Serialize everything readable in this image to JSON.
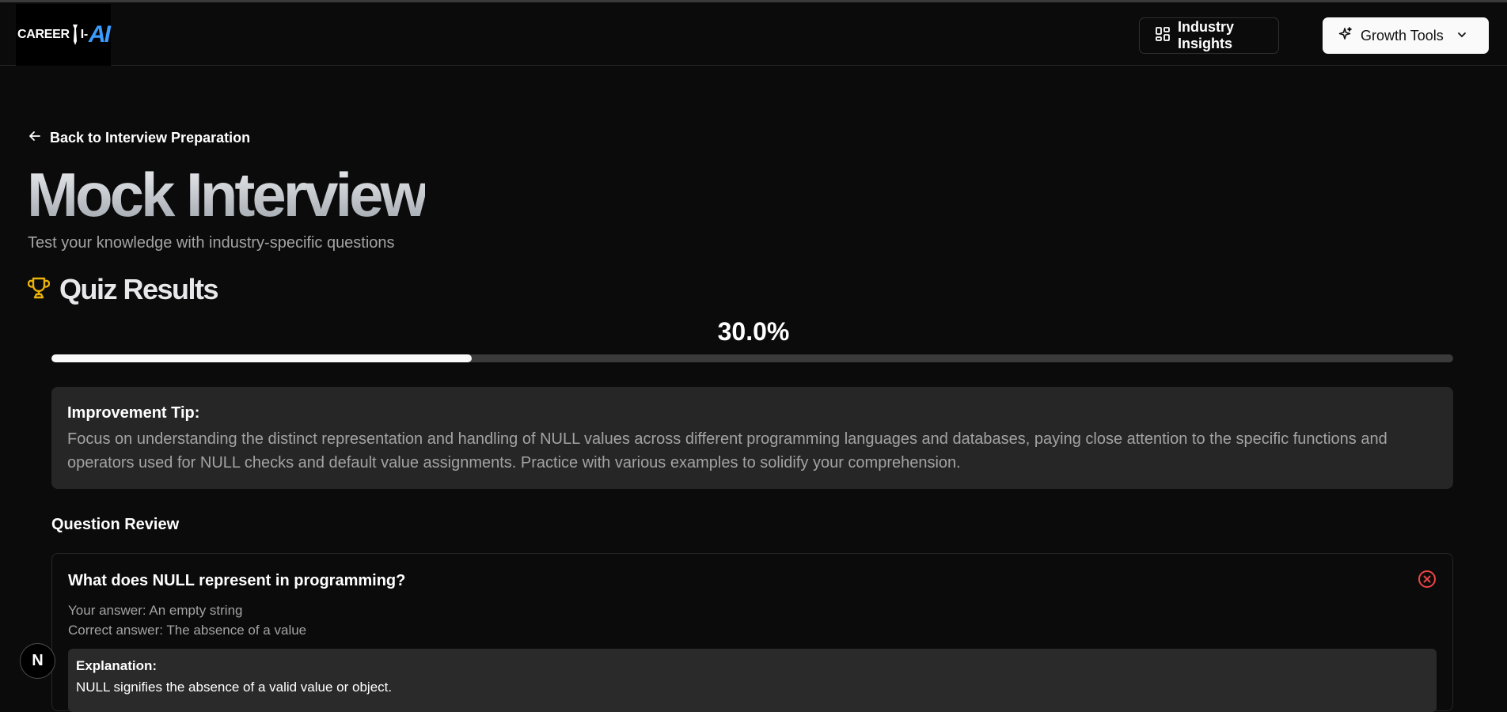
{
  "header": {
    "logo_text": "CAREER",
    "logo_dash": "I-",
    "logo_ai": "AI",
    "industry_button": "Industry Insights",
    "growth_button": "Growth Tools"
  },
  "back_link": "Back to Interview Preparation",
  "page": {
    "title": "Mock Interview",
    "subtitle": "Test your knowledge with industry-specific questions"
  },
  "results": {
    "title": "Quiz Results",
    "score_text": "30.0%",
    "score_fraction": 0.3,
    "tip_label": "Improvement Tip:",
    "tip_text": "Focus on understanding the distinct representation and handling of NULL values across different programming languages and databases, paying close attention to the specific functions and operators used for NULL checks and default value assignments. Practice with various examples to solidify your comprehension."
  },
  "review": {
    "label": "Question Review",
    "questions": [
      {
        "question": "What does NULL represent in programming?",
        "your_answer": "Your answer: An empty string",
        "correct_answer": "Correct answer: The absence of a value",
        "explanation_label": "Explanation:",
        "explanation": "NULL signifies the absence of a valid value or object.",
        "status_icon": "x-circle-icon",
        "status_color": "#ef4444"
      }
    ]
  },
  "badge": {
    "letter": "N"
  },
  "colors": {
    "accent_trophy": "#eab308",
    "logo_ai": "#3b9bff",
    "background": "#0b0b0b"
  }
}
